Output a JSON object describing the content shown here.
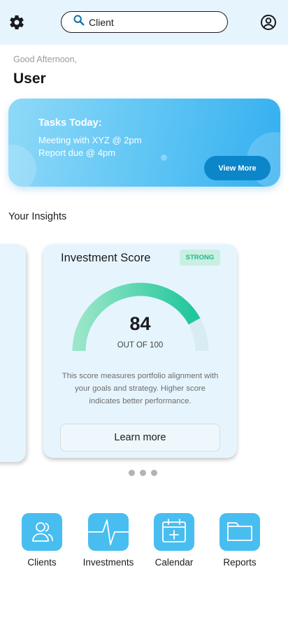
{
  "header": {
    "search_value": "Client",
    "icons": [
      "gear-icon",
      "search-icon",
      "account-icon"
    ]
  },
  "greeting": {
    "text": "Good Afternoon,",
    "user": "User"
  },
  "tasks": {
    "title": "Tasks Today:",
    "items": [
      "Meeting with XYZ  @ 2pm",
      "Report due @ 4pm"
    ],
    "button": "View More"
  },
  "insights": {
    "title": "Your Insights",
    "card": {
      "title": "Investment Score",
      "badge": "STRONG",
      "score": "84",
      "score_fraction": 0.84,
      "out_of": "OUT OF 100",
      "description": "This score measures portfolio alignment with your goals and strategy. Higher score indicates better performance.",
      "button": "Learn more"
    },
    "pager": {
      "count": 3
    }
  },
  "nav": [
    {
      "label": "Clients",
      "icon": "users-icon"
    },
    {
      "label": "Investments",
      "icon": "pulse-chart-icon"
    },
    {
      "label": "Calendar",
      "icon": "calendar-add-icon"
    },
    {
      "label": "Reports",
      "icon": "folder-icon"
    }
  ],
  "colors": {
    "header_bg": "#e6f5fd",
    "accent": "#48bef0",
    "button_dark": "#0b86c9",
    "strong_green": "#22b989",
    "gauge_start": "#9ae6c8",
    "gauge_end": "#1fc79a",
    "gauge_track": "#d9ecf3"
  }
}
